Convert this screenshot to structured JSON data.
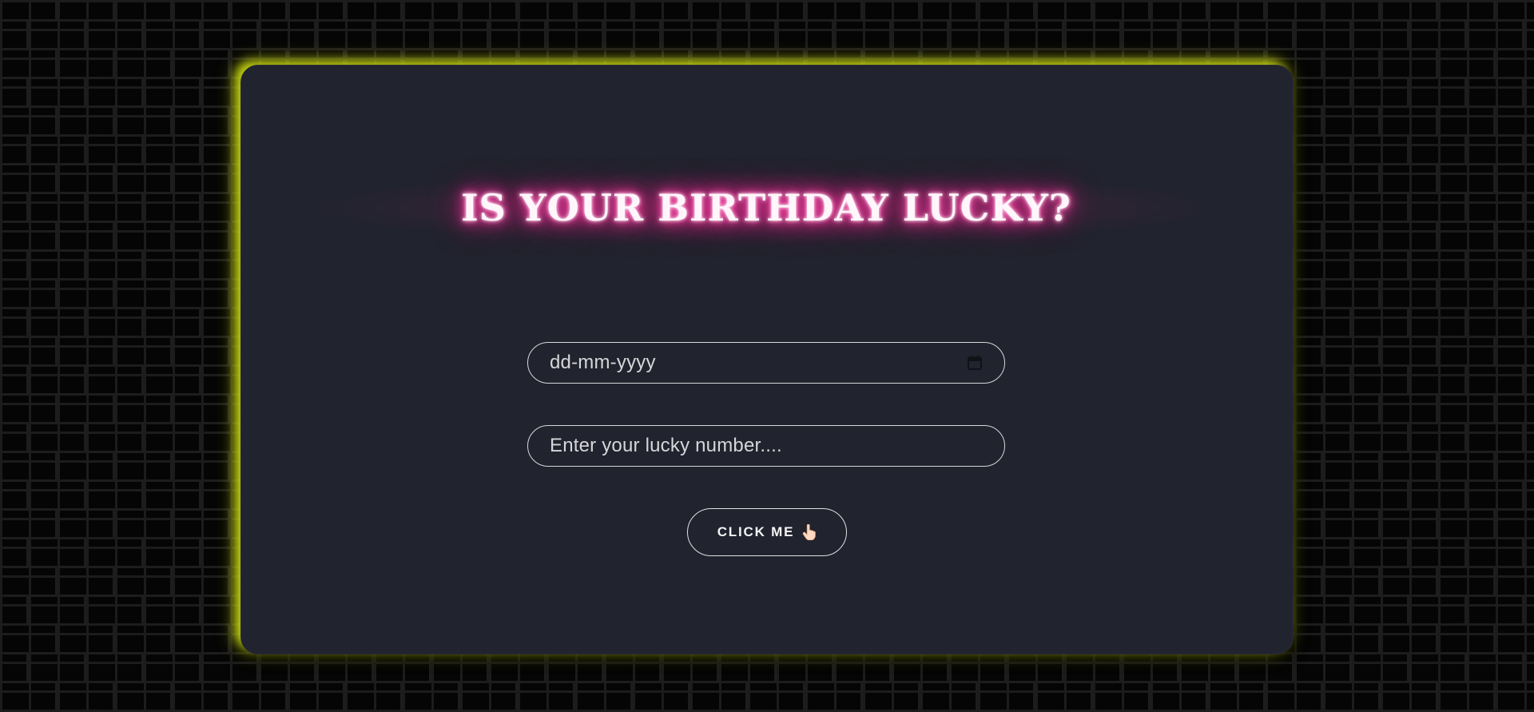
{
  "page": {
    "background_color": "#050505",
    "brick_line_color": "#1d1d1d"
  },
  "card": {
    "background_color": "#21232e",
    "glow_color": "#c8d714"
  },
  "title": {
    "text": "IS YOUR BIRTHDAY LUCKY?",
    "glow_color": "#e62b8e"
  },
  "form": {
    "date_input": {
      "placeholder": "dd-mm-yyyy",
      "icon": "calendar-icon"
    },
    "lucky_number_input": {
      "placeholder": "Enter your lucky number...."
    },
    "submit_button": {
      "label": "CLICK ME",
      "icon": "pointing-hand-icon"
    }
  }
}
